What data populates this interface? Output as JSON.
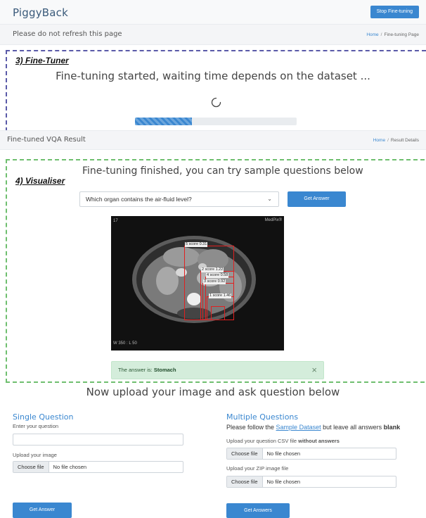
{
  "header": {
    "brand": "PiggyBack",
    "stop_button": "Stop Fine-tuning"
  },
  "bar1": {
    "message": "Please do not refresh this page",
    "crumb_home": "Home",
    "crumb_sep": "/",
    "crumb_page": "Fine-tuning Page"
  },
  "finetuner": {
    "step_label": "3) Fine-Tuner",
    "status": "Fine-tuning started, waiting time depends on the dataset ...",
    "progress_fraction": 0.35
  },
  "bar2": {
    "title": "Fine-tuned VQA Result",
    "crumb_home": "Home",
    "crumb_sep": "/",
    "crumb_page": "Result Details"
  },
  "visualiser": {
    "step_label": "4) Visualiser",
    "heading": "Fine-tuning finished, you can try sample questions below",
    "selected_question": "Which organ contains the air-fluid level?",
    "get_answer": "Get Answer",
    "image": {
      "corner_tl": "17",
      "corner_tr": "MedPix®",
      "corner_bl": "W 350 : L 50",
      "boxes": [
        "5 score 0.31",
        "2 score 1.22",
        "4 score 0.58",
        "3 score 0.92",
        "1 score 1.46"
      ]
    },
    "answer_prefix": "The answer is: ",
    "answer_value": "Stomach",
    "close_symbol": "×"
  },
  "upload": {
    "heading": "Now upload your image and ask question below",
    "single": {
      "title": "Single Question",
      "question_label": "Enter your question",
      "question_value": "",
      "image_label": "Upload your image",
      "choose_file": "Choose file",
      "no_file": "No file chosen",
      "submit": "Get Answer"
    },
    "multiple": {
      "title": "Multiple Questions",
      "follow_prefix": "Please follow the ",
      "sample_link": "Sample Dataset",
      "follow_middle": " but leave all answers ",
      "follow_bold": "blank",
      "csv_label_prefix": "Upload your question CSV file ",
      "csv_label_bold": "without answers",
      "zip_label": "Upload your ZIP image file",
      "choose_file": "Choose file",
      "no_file": "No file chosen",
      "submit": "Get Answers"
    }
  }
}
